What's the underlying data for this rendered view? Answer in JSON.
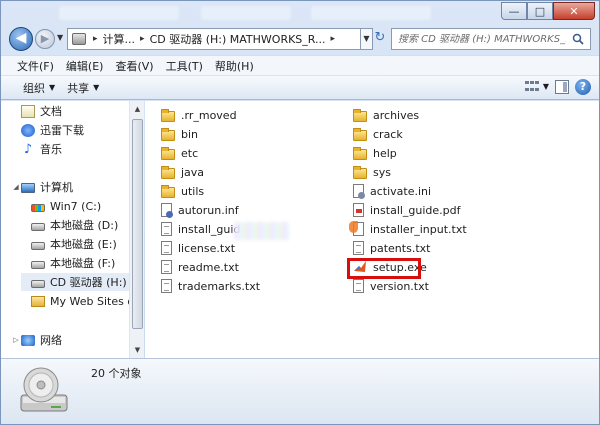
{
  "title_bar": {
    "minimize_symbol": "—",
    "maximize_symbol": "□",
    "close_symbol": "✕"
  },
  "address_bar": {
    "crumbs": [
      "计算...",
      "CD 驱动器 (H:) MATHWORKS_R..."
    ],
    "search_placeholder": "搜索 CD 驱动器 (H:) MATHWORKS_..."
  },
  "menu": {
    "items": [
      "文件(F)",
      "编辑(E)",
      "查看(V)",
      "工具(T)",
      "帮助(H)"
    ]
  },
  "toolbar": {
    "organize": "组织",
    "share": "共享",
    "help_symbol": "?"
  },
  "nav_pane": {
    "favorites": [
      "文档",
      "迅雷下载",
      "音乐"
    ],
    "computer": "计算机",
    "drives": [
      "Win7 (C:)",
      "本地磁盘 (D:)",
      "本地磁盘 (E:)",
      "本地磁盘 (F:)",
      "CD 驱动器 (H:) M",
      "My Web Sites or"
    ],
    "network": "网络"
  },
  "files": {
    "left_column": [
      {
        "name": ".rr_moved",
        "icon": "folder-icon"
      },
      {
        "name": "bin",
        "icon": "folder-icon"
      },
      {
        "name": "etc",
        "icon": "folder-icon"
      },
      {
        "name": "java",
        "icon": "folder-icon"
      },
      {
        "name": "utils",
        "icon": "folder-icon"
      },
      {
        "name": "autorun.inf",
        "icon": "inf-file-icon"
      },
      {
        "name": "install_guid",
        "icon": "document-icon"
      },
      {
        "name": "license.txt",
        "icon": "text-file-icon"
      },
      {
        "name": "readme.txt",
        "icon": "text-file-icon"
      },
      {
        "name": "trademarks.txt",
        "icon": "text-file-icon"
      }
    ],
    "right_column": [
      {
        "name": "archives",
        "icon": "folder-icon"
      },
      {
        "name": "crack",
        "icon": "folder-icon"
      },
      {
        "name": "help",
        "icon": "folder-icon"
      },
      {
        "name": "sys",
        "icon": "folder-icon"
      },
      {
        "name": "activate.ini",
        "icon": "ini-file-icon"
      },
      {
        "name": "install_guide.pdf",
        "icon": "pdf-file-icon"
      },
      {
        "name": "installer_input.txt",
        "icon": "installer-file-icon"
      },
      {
        "name": "patents.txt",
        "icon": "text-file-icon"
      },
      {
        "name": "setup.exe",
        "icon": "matlab-icon"
      },
      {
        "name": "version.txt",
        "icon": "text-file-icon"
      }
    ]
  },
  "status": {
    "count_text": "20 个对象"
  },
  "colors": {
    "highlight": "#d80d0d",
    "window_frame": "#c4d6ee"
  }
}
